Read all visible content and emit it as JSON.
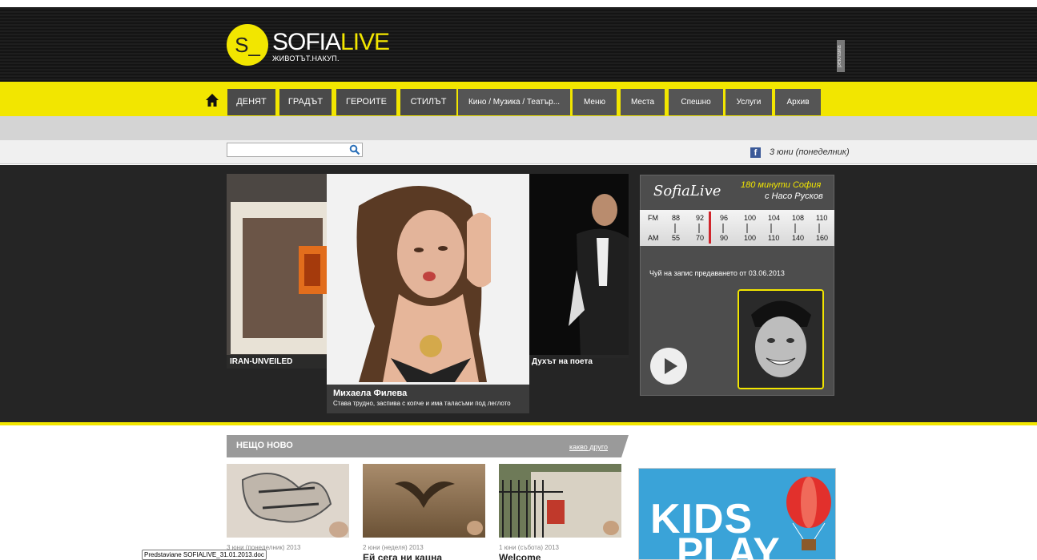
{
  "header": {
    "logo_mark": "S_",
    "logo_sofia": "SOFIA",
    "logo_live": "LIVE",
    "tagline": "ЖИВОТЪТ.НАКУП.",
    "ad_label": "реклама"
  },
  "nav": {
    "items": [
      {
        "label": "ДЕНЯТ"
      },
      {
        "label": "ГРАДЪТ"
      },
      {
        "label": "ГЕРОИТЕ"
      },
      {
        "label": "СТИЛЪТ"
      },
      {
        "label": "Кино / Музика / Театър..."
      },
      {
        "label": "Меню"
      },
      {
        "label": "Места"
      },
      {
        "label": "Спешно"
      },
      {
        "label": "Услуги"
      },
      {
        "label": "Архив"
      }
    ]
  },
  "search": {
    "placeholder": ""
  },
  "date": "3 юни (понеделник)",
  "slides": [
    {
      "caption": "IRAN-UNVEILED"
    },
    {
      "title": "Михаела Филева",
      "subtitle": "Става трудно, заспива с копче и има таласъми под леглото"
    },
    {
      "caption": "Духът на поета"
    }
  ],
  "radio": {
    "logo": "SofiaLive",
    "line1": "180 минути София",
    "line2": "с Насо Русков",
    "dial_fm": [
      "FM",
      "88",
      "92",
      "96",
      "100",
      "104",
      "108",
      "110"
    ],
    "dial_am": [
      "AM",
      "55",
      "70",
      "90",
      "100",
      "110",
      "140",
      "160"
    ],
    "record_text": "Чуй на запис предаването от 03.06.2013"
  },
  "news": {
    "title": "НЕЩО НОВО",
    "more": "какво друго",
    "items": [
      {
        "date": "3 юни (понеделник) 2013",
        "title": ""
      },
      {
        "date": "2 юни (неделя) 2013",
        "title": "Ей сега ни кацна"
      },
      {
        "date": "1 юни (събота) 2013",
        "title": "Welcome"
      }
    ]
  },
  "tooltip": "Predstaviane SOFIALIVE_31.01.2013.doc",
  "ad": {
    "line1": "KIDS",
    "line2": "PLAY"
  },
  "colors": {
    "accent": "#f2e600",
    "dark": "#252525",
    "nav": "#4a4a4a"
  }
}
